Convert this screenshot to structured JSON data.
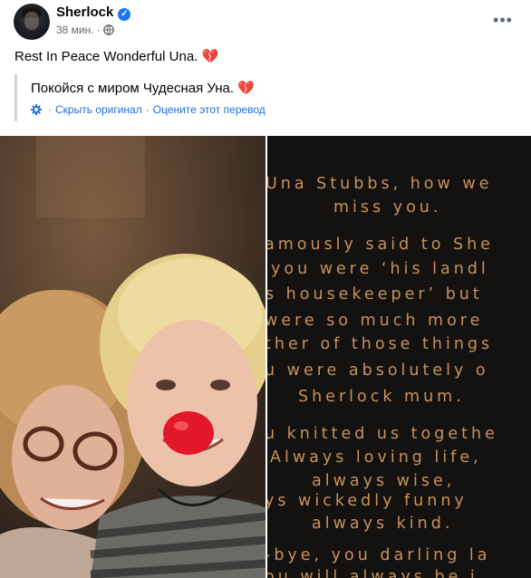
{
  "post": {
    "author": "Sherlock",
    "time": "38 мин.",
    "dot": "·",
    "text": "Rest In Peace Wonderful Una.",
    "heart": "💔"
  },
  "translation": {
    "text": "Покойся с миром Чудесная Уна.",
    "heart": "💔",
    "show_original": "Скрыть оригинал",
    "separator": "·",
    "rate": "Оцените этот перевод"
  },
  "image_text": {
    "lines": [
      "Una Stubbs, how we",
      "miss you.",
      "amously said to She",
      "you were ‘his landl",
      "s housekeeper’ but",
      "were so much more",
      "ther of those things",
      "u were absolutely o",
      "Sherlock mum.",
      "u knitted us togethe",
      "Always loving life,",
      "always wise,",
      "ys wickedly funny",
      "always kind.",
      "-bye, you darling la",
      "ou will always be i"
    ]
  },
  "colors": {
    "accent": "#1877f2",
    "link": "#216fdb",
    "poem_text": "#c9915a",
    "heart": "#d9414f"
  },
  "icons": {
    "verified": "verified-badge-icon",
    "globe": "globe-icon",
    "more": "more-options-icon",
    "gear": "translation-settings-icon"
  }
}
